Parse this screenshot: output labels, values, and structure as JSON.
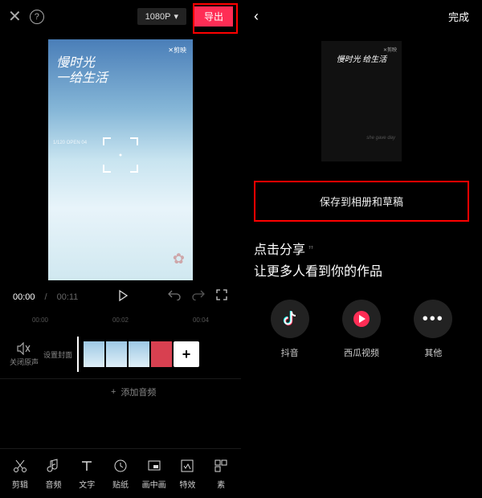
{
  "left": {
    "resolution": "1080P",
    "export": "导出",
    "preview_title_line1": "慢时光",
    "preview_title_line2": "一给生活",
    "preview_logo": "✕剪映",
    "side_text": "1/120\nOPEN\n04",
    "time_current": "00:00",
    "time_total": "00:11",
    "ruler": [
      "00:00",
      "00:02",
      "00:04"
    ],
    "mute_label": "关闭原声",
    "cover_label": "设置封面",
    "add_audio": "添加音频",
    "tools": [
      {
        "icon": "scissors",
        "label": "剪辑"
      },
      {
        "icon": "note",
        "label": "音频"
      },
      {
        "icon": "text",
        "label": "文字"
      },
      {
        "icon": "clock",
        "label": "贴纸"
      },
      {
        "icon": "pip",
        "label": "画中画"
      },
      {
        "icon": "fx",
        "label": "特效"
      },
      {
        "icon": "more",
        "label": "素"
      }
    ]
  },
  "right": {
    "done": "完成",
    "preview_title": "慢时光 给生活",
    "preview_logo": "✕剪映",
    "preview_sub": "she gave day",
    "save_label": "保存到相册和草稿",
    "share_line1": "点击分享",
    "share_line2": "让更多人看到你的作品",
    "share_items": [
      {
        "name": "douyin",
        "label": "抖音"
      },
      {
        "name": "xigua",
        "label": "西瓜视频"
      },
      {
        "name": "other",
        "label": "其他"
      }
    ]
  }
}
